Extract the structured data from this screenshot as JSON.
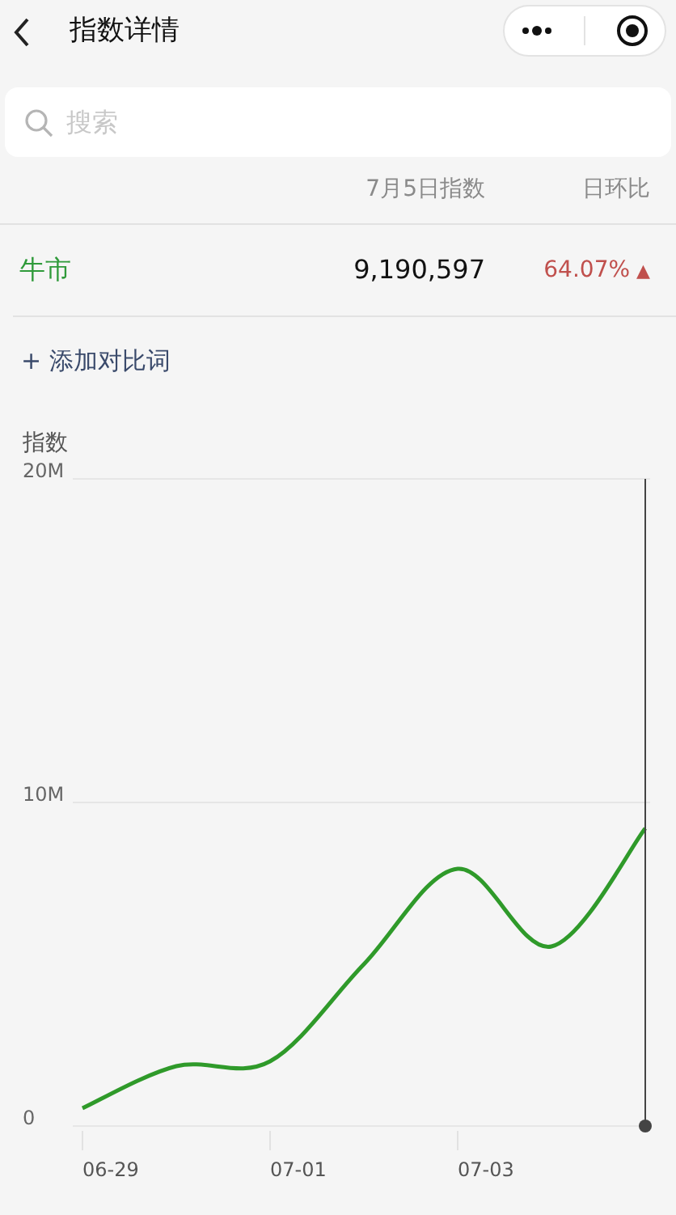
{
  "nav": {
    "title": "指数详情"
  },
  "search": {
    "placeholder": "搜索"
  },
  "table": {
    "columns": [
      "7月5日指数",
      "日环比"
    ],
    "rows": [
      {
        "keyword": "牛市",
        "color": "#2f9a3a",
        "index": "9,190,597",
        "change": "64.07%",
        "arrow": "▲"
      }
    ]
  },
  "add_compare": "+ 添加对比词",
  "chart": {
    "label": "指数",
    "chart_data": {
      "type": "line",
      "categories": [
        "06-29",
        null,
        "07-01",
        null,
        "07-03",
        null,
        null
      ],
      "series": [
        {
          "color": "#2f9a2a",
          "values": [
            550000,
            1850000,
            2000000,
            5000000,
            7950000,
            5550000,
            9200000
          ]
        }
      ],
      "ylim": [
        0,
        20000000
      ],
      "yticks": [
        {
          "value": 0,
          "label": "0"
        },
        {
          "value": 10000000,
          "label": "10M"
        },
        {
          "value": 20000000,
          "label": "20M"
        }
      ]
    }
  }
}
